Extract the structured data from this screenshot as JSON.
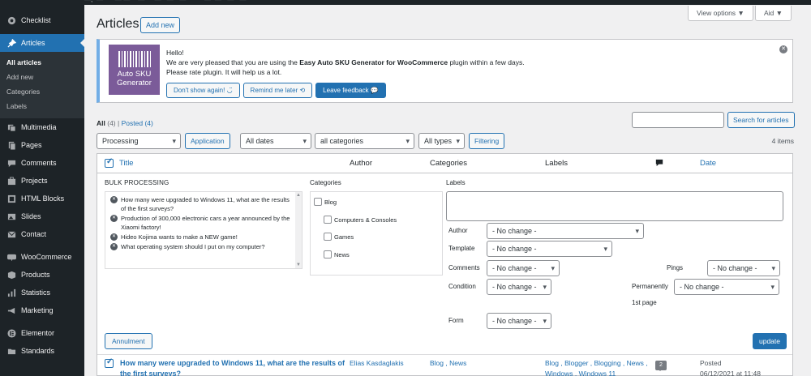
{
  "topbar": {
    "strip_text": "—, ·—·  ·  ·  —·—·  · —·  ·  ·—  ·  —·  ·—·  ··  ·  ··—  ·—  ··—  ·  —"
  },
  "sidebar": {
    "items_top": [
      {
        "label": "Checklist",
        "icon": "checklist-icon"
      }
    ],
    "active": {
      "label": "Articles",
      "icon": "pin-icon"
    },
    "submenu": [
      {
        "label": "All articles",
        "current": true
      },
      {
        "label": "Add new"
      },
      {
        "label": "Categories"
      },
      {
        "label": "Labels"
      }
    ],
    "items": [
      {
        "label": "Multimedia",
        "icon": "media-icon"
      },
      {
        "label": "Pages",
        "icon": "pages-icon"
      },
      {
        "label": "Comments",
        "icon": "comments-icon"
      },
      {
        "label": "Projects",
        "icon": "projects-icon"
      },
      {
        "label": "HTML Blocks",
        "icon": "html-blocks-icon"
      },
      {
        "label": "Slides",
        "icon": "slides-icon"
      },
      {
        "label": "Contact",
        "icon": "contact-icon"
      },
      {
        "label": "WooCommerce",
        "icon": "woocommerce-icon"
      },
      {
        "label": "Products",
        "icon": "products-icon"
      },
      {
        "label": "Statistics",
        "icon": "statistics-icon"
      },
      {
        "label": "Marketing",
        "icon": "marketing-icon"
      },
      {
        "label": "Elementor",
        "icon": "elementor-icon"
      },
      {
        "label": "Standards",
        "icon": "standards-icon"
      }
    ]
  },
  "header": {
    "title": "Articles",
    "add_new": "Add new",
    "view_options": "View options ▼",
    "aid": "Aid ▼"
  },
  "notice": {
    "logo_line1": "Auto SKU",
    "logo_line2": "Generator",
    "hello": "Hello!",
    "msg_pre": "We are very pleased that you are using the ",
    "msg_plugin": "Easy Auto SKU Generator for WooCommerce",
    "msg_post": " plugin within a few days.",
    "rate": "Please rate plugin. It will help us a lot.",
    "btn_dont": "Don't show again!  ◡̈",
    "btn_remind": "Remind me later  ⟲",
    "btn_feedback": "Leave feedback  💬"
  },
  "filters": {
    "all": "All",
    "all_count": "(4)",
    "sep": "|",
    "posted": "Posted",
    "posted_count": "(4)",
    "search_btn": "Search for articles",
    "bulk_select": "Processing",
    "apply": "Application",
    "dates": "All dates",
    "categories": "all categories",
    "types": "All types",
    "filter_btn": "Filtering",
    "items_count": "4 items"
  },
  "table": {
    "col_title": "Title",
    "col_author": "Author",
    "col_categories": "Categories",
    "col_labels": "Labels",
    "col_date": "Date"
  },
  "bulk": {
    "title": "BULK PROCESSING",
    "posts": [
      "How many were upgraded to Windows 11, what are the results of the first surveys?",
      "Production of 300,000 electronic cars a year announced by the Xiaomi factory!",
      "Hideo Kojima wants to make a NEW game!",
      "What operating system should I put on my computer?"
    ],
    "categories_label": "Categories",
    "categories": [
      "Blog",
      "Computers & Consoles",
      "Games",
      "News"
    ],
    "labels_label": "Labels",
    "author_label": "Author",
    "author_value": "- No change -",
    "template_label": "Template",
    "template_value": "- No change -",
    "comments_label": "Comments",
    "comments_value": "- No change -",
    "pings_label": "Pings",
    "pings_value": "- No change -",
    "condition_label": "Condition",
    "condition_value": "- No change -",
    "permanently_label": "Permanently",
    "permanently_value": "- No change -",
    "first_page": "1st page",
    "form_label": "Form",
    "form_value": "- No change -",
    "annul": "Annulment",
    "update": "update"
  },
  "row": {
    "title": "How many were upgraded to Windows 11, what are the results of the first surveys?",
    "author": "Elias Kasdaglakis",
    "categories": "Blog , News",
    "labels_line1": "Blog , Blogger , Blogging , News ,",
    "labels_line2": "Windows , Windows 11",
    "comments": "2",
    "date_status": "Posted",
    "date_value": "06/12/2021 at 11:48"
  }
}
